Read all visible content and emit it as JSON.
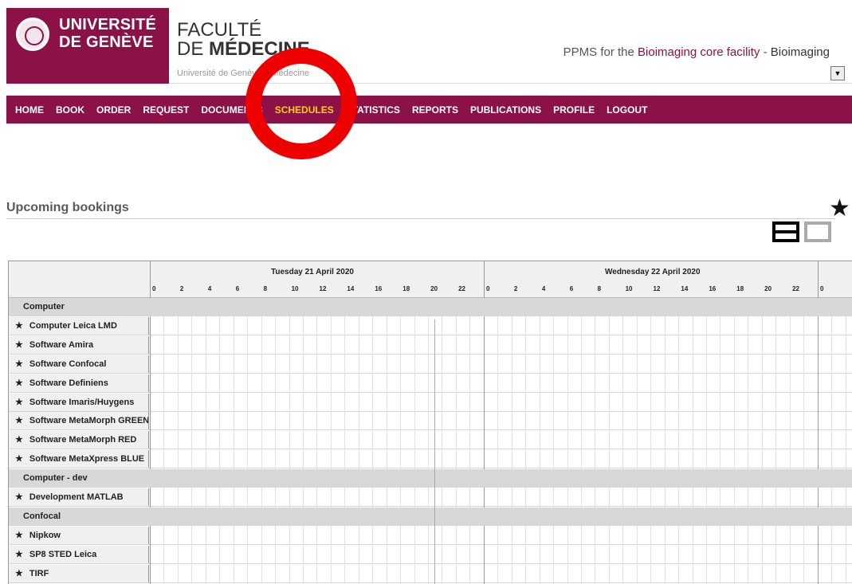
{
  "header": {
    "university_line1": "UNIVERSITÉ",
    "university_line2": "DE GENÈVE",
    "faculty_line1": "FACULTÉ",
    "faculty_line2_prefix": "DE ",
    "faculty_line2_bold": "MÉDECINE",
    "breadcrumb": "Université de Genève > Médecine",
    "ppms_prefix": "PPMS for the ",
    "core_facility": "Bioimaging core facility",
    "separator": " - ",
    "facility_select": "Bioimaging",
    "dropdown_glyph": "▼"
  },
  "nav": {
    "items": [
      "HOME",
      "BOOK",
      "ORDER",
      "REQUEST",
      "DOCUMENTS",
      "SCHEDULES",
      "STATISTICS",
      "REPORTS",
      "PUBLICATIONS",
      "PROFILE",
      "LOGOUT"
    ],
    "active": "SCHEDULES"
  },
  "section_title": "Upcoming bookings",
  "favorite_glyph": "★",
  "schedule": {
    "days": [
      "Tuesday 21 April 2020",
      "Wednesday 22 April 2020"
    ],
    "hour_labels": [
      "0",
      "2",
      "4",
      "6",
      "8",
      "10",
      "12",
      "14",
      "16",
      "18",
      "20",
      "22"
    ],
    "trailing_hour": "0",
    "star_glyph": "★",
    "groups": [
      {
        "name": "Computer",
        "systems": [
          "Computer Leica LMD",
          "Software Amira",
          "Software Confocal",
          "Software Definiens",
          "Software Imaris/Huygens",
          "Software MetaMorph GREEN",
          "Software MetaMorph RED",
          "Software MetaXpress BLUE"
        ]
      },
      {
        "name": "Computer - dev",
        "systems": [
          "Development MATLAB"
        ]
      },
      {
        "name": "Confocal",
        "systems": [
          "Nipkow",
          "SP8 STED Leica",
          "TIRF"
        ]
      }
    ]
  },
  "colors": {
    "brand": "#8c1147",
    "active_nav": "#ffd400",
    "annotation_circle": "#ee0000",
    "now_line": "#f0a030"
  }
}
